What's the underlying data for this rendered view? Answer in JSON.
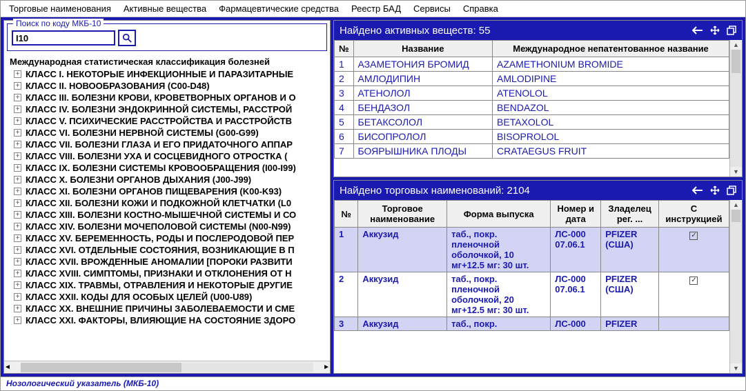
{
  "menu": [
    "Торговые наименования",
    "Активные вещества",
    "Фармацевтические средства",
    "Реестр БАД",
    "Сервисы",
    "Справка"
  ],
  "search": {
    "group_title": "Поиск по коду  МКБ-10",
    "value": "I10"
  },
  "tree": {
    "root": "Международная статистическая классификация болезней",
    "items": [
      "КЛАСС I. НЕКОТОРЫЕ ИНФЕКЦИОННЫЕ И ПАРАЗИТАРНЫЕ",
      "КЛАСС II. НОВООБРАЗОВАНИЯ (C00-D48)",
      "КЛАСС III. БОЛЕЗНИ КРОВИ, КРОВЕТВОРНЫХ ОРГАНОВ И О",
      "КЛАСС IV. БОЛЕЗНИ ЭНДОКРИННОЙ СИСТЕМЫ, РАССТРОЙ",
      "КЛАСС V. ПСИХИЧЕСКИЕ РАССТРОЙСТВА И РАССТРОЙСТВ",
      "КЛАСС VI. БОЛЕЗНИ НЕРВНОЙ СИСТЕМЫ (G00-G99)",
      "КЛАСС VII. БОЛЕЗНИ ГЛАЗА И ЕГО ПРИДАТОЧНОГО АППАР",
      "КЛАСС VIII. БОЛЕЗНИ УХА И СОСЦЕВИДНОГО ОТРОСТКА (",
      "КЛАСС IX. БОЛЕЗНИ СИСТЕМЫ КРОВООБРАЩЕНИЯ (I00-I99)",
      "КЛАСС X. БОЛЕЗНИ ОРГАНОВ ДЫХАНИЯ (J00-J99)",
      "КЛАСС XI. БОЛЕЗНИ ОРГАНОВ ПИЩЕВАРЕНИЯ (K00-K93)",
      "КЛАСС XII. БОЛЕЗНИ КОЖИ И ПОДКОЖНОЙ КЛЕТЧАТКИ (L0",
      "КЛАСС XIII. БОЛЕЗНИ КОСТНО-МЫШЕЧНОЙ СИСТЕМЫ И СО",
      "КЛАСС XIV. БОЛЕЗНИ МОЧЕПОЛОВОЙ СИСТЕМЫ (N00-N99)",
      "КЛАСС XV. БЕРЕМЕННОСТЬ, РОДЫ И ПОСЛЕРОДОВОЙ ПЕР",
      "КЛАСС XVI. ОТДЕЛЬНЫЕ СОСТОЯНИЯ, ВОЗНИКАЮЩИЕ В П",
      "КЛАСС XVII. ВРОЖДЕННЫЕ АНОМАЛИИ [ПОРОКИ РАЗВИТИ",
      "КЛАСС XVIII. СИМПТОМЫ, ПРИЗНАКИ И ОТКЛОНЕНИЯ ОТ Н",
      "КЛАСС XIX. ТРАВМЫ, ОТРАВЛЕНИЯ И НЕКОТОРЫЕ ДРУГИЕ",
      "КЛАСС XXII. КОДЫ ДЛЯ ОСОБЫХ ЦЕЛЕЙ (U00-U89)",
      "КЛАСС XX. ВНЕШНИЕ ПРИЧИНЫ ЗАБОЛЕВАЕМОСТИ И СМЕ",
      "КЛАСС XXI. ФАКТОРЫ, ВЛИЯЮЩИЕ НА СОСТОЯНИЕ ЗДОРО"
    ]
  },
  "substances": {
    "title": "Найдено активных веществ: 55",
    "columns": {
      "num": "№",
      "name": "Название",
      "inn": "Международное непатентованное название"
    },
    "rows": [
      {
        "n": "1",
        "name": "АЗАМЕТОНИЯ БРОМИД",
        "inn": "AZAMETHONIUM BROMIDE"
      },
      {
        "n": "2",
        "name": "АМЛОДИПИН",
        "inn": "AMLODIPINE"
      },
      {
        "n": "3",
        "name": "АТЕНОЛОЛ",
        "inn": "ATENOLOL"
      },
      {
        "n": "4",
        "name": "БЕНДАЗОЛ",
        "inn": "BENDAZOL"
      },
      {
        "n": "5",
        "name": "БЕТАКСОЛОЛ",
        "inn": "BETAXOLOL"
      },
      {
        "n": "6",
        "name": "БИСОПРОЛОЛ",
        "inn": "BISOPROLOL"
      },
      {
        "n": "7",
        "name": "БОЯРЫШНИКА ПЛОДЫ",
        "inn": "CRATAEGUS FRUIT"
      }
    ]
  },
  "trade": {
    "title": "Найдено торговых наименований: 2104",
    "columns": {
      "num": "№",
      "name": "Торговое наименование",
      "form": "Форма выпуска",
      "reg": "Номер и дата",
      "owner": "Зладелец рег. ...",
      "instr": "С инструкцией"
    },
    "rows": [
      {
        "n": "1",
        "name": "Аккузид",
        "form": "таб., покр. пленочной оболочкой, 10 мг+12.5 мг: 30 шт.",
        "reg": "ЛС-000 07.06.1",
        "owner": "PFIZER (США)",
        "instr": "✓",
        "hl": true
      },
      {
        "n": "2",
        "name": "Аккузид",
        "form": "таб., покр. пленочной оболочкой, 20 мг+12.5 мг: 30 шт.",
        "reg": "ЛС-000 07.06.1",
        "owner": "PFIZER (США)",
        "instr": "✓",
        "hl": false
      },
      {
        "n": "3",
        "name": "Аккузид",
        "form": "таб., покр.",
        "reg": "ЛС-000",
        "owner": "PFIZER",
        "instr": "",
        "hl": true
      }
    ]
  },
  "status": "Нозологический указатель (МКБ-10)"
}
